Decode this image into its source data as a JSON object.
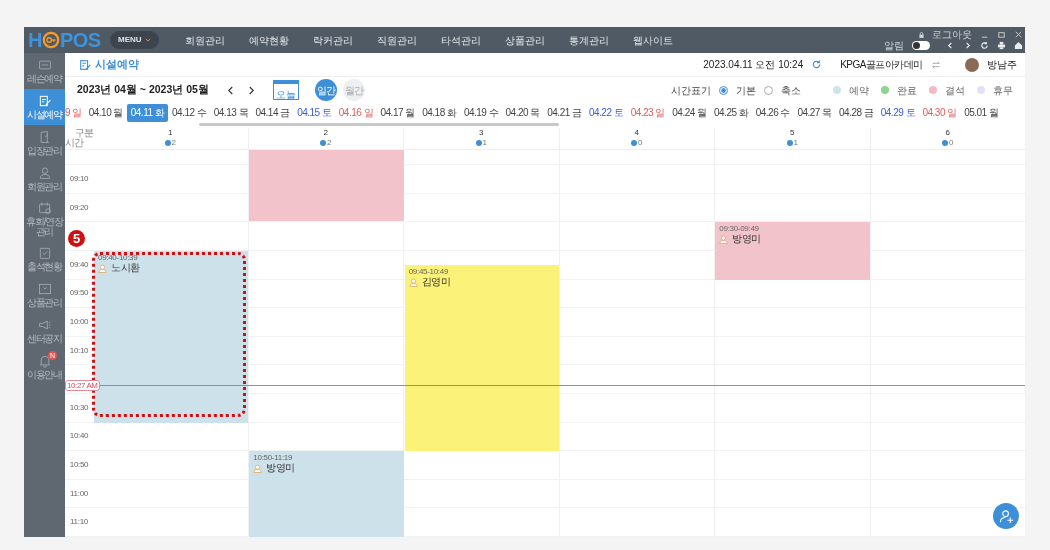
{
  "topbar": {
    "logo": [
      "H",
      "POS"
    ],
    "menu_button": "MENU",
    "nav": [
      "회원관리",
      "예약현황",
      "락커관리",
      "직원관리",
      "타석관리",
      "상품관리",
      "통계관리",
      "웹사이트"
    ],
    "logout": "로그아웃",
    "alarm": {
      "label": "알림",
      "on": false
    }
  },
  "sidebar": {
    "items": [
      {
        "label": "레슨예약",
        "kind": "ticket",
        "selected": false
      },
      {
        "label": "시설예약",
        "kind": "edit",
        "selected": true
      },
      {
        "label": "입장관리",
        "kind": "door",
        "selected": false
      },
      {
        "label": "회원관리",
        "kind": "person",
        "selected": false
      },
      {
        "label": "휴회/연장관리",
        "kind": "calendar",
        "selected": false
      },
      {
        "label": "출석현황",
        "kind": "clipboard",
        "selected": false
      },
      {
        "label": "상품관리",
        "kind": "board",
        "selected": false
      },
      {
        "label": "센터공지",
        "kind": "megaphone",
        "selected": false
      },
      {
        "label": "이용안내",
        "kind": "bell",
        "selected": false,
        "badge": "N"
      }
    ]
  },
  "header": {
    "title": "시설예약",
    "datetime": "2023.04.11 오전 10:24",
    "center": "KPGA골프아카데미",
    "user": "방남주"
  },
  "controls": {
    "range": "2023년 04월 ~ 2023년 05월",
    "today": "오늘",
    "views": [
      {
        "label": "일간",
        "selected": true
      },
      {
        "label": "월간",
        "selected": false
      }
    ],
    "time_display": {
      "label": "시간표기",
      "options": [
        {
          "label": "기본",
          "selected": true
        },
        {
          "label": "축소",
          "selected": false
        }
      ]
    },
    "legend": [
      {
        "label": "예약",
        "color": "#cfe2ee"
      },
      {
        "label": "완료",
        "color": "#8ed48a"
      },
      {
        "label": "결석",
        "color": "#f3b9c4"
      },
      {
        "label": "휴무",
        "color": "#e4e0f6"
      }
    ]
  },
  "dates": [
    {
      "label": "9 일",
      "kind": "sun",
      "selected": false
    },
    {
      "label": "04.10 월",
      "kind": "weekday",
      "selected": false
    },
    {
      "label": "04.11 화",
      "kind": "weekday",
      "selected": true
    },
    {
      "label": "04.12 수",
      "kind": "weekday",
      "selected": false
    },
    {
      "label": "04.13 목",
      "kind": "weekday",
      "selected": false
    },
    {
      "label": "04.14 금",
      "kind": "weekday",
      "selected": false
    },
    {
      "label": "04.15 토",
      "kind": "sat",
      "selected": false
    },
    {
      "label": "04.16 일",
      "kind": "sun",
      "selected": false
    },
    {
      "label": "04.17 월",
      "kind": "weekday",
      "selected": false
    },
    {
      "label": "04.18 화",
      "kind": "weekday",
      "selected": false
    },
    {
      "label": "04.19 수",
      "kind": "weekday",
      "selected": false
    },
    {
      "label": "04.20 목",
      "kind": "weekday",
      "selected": false
    },
    {
      "label": "04.21 금",
      "kind": "weekday",
      "selected": false
    },
    {
      "label": "04.22 토",
      "kind": "sat",
      "selected": false
    },
    {
      "label": "04.23 일",
      "kind": "sun",
      "selected": false
    },
    {
      "label": "04.24 월",
      "kind": "weekday",
      "selected": false
    },
    {
      "label": "04.25 화",
      "kind": "weekday",
      "selected": false
    },
    {
      "label": "04.26 수",
      "kind": "weekday",
      "selected": false
    },
    {
      "label": "04.27 목",
      "kind": "weekday",
      "selected": false
    },
    {
      "label": "04.28 금",
      "kind": "weekday",
      "selected": false
    },
    {
      "label": "04.29 토",
      "kind": "sat",
      "selected": false
    },
    {
      "label": "04.30 일",
      "kind": "sun",
      "selected": false
    },
    {
      "label": "05.01 월",
      "kind": "weekday",
      "selected": false
    }
  ],
  "grid": {
    "corner": [
      "구분",
      "시간"
    ],
    "columns": [
      {
        "label": "1",
        "count": "2",
        "events": [
          {
            "time": "09:40-10:39",
            "name": "노시환",
            "color": "#cde1eb",
            "callout": "5"
          }
        ]
      },
      {
        "label": "2",
        "count": "2",
        "events": [
          {
            "kind": "continued",
            "color": "#f3c3cb"
          },
          {
            "time": "10:50-11:19",
            "name": "방영미",
            "color": "#cde1eb"
          }
        ]
      },
      {
        "label": "3",
        "count": "1",
        "events": [
          {
            "time": "09:45-10:49",
            "name": "김영미",
            "color": "#fbf27a"
          }
        ]
      },
      {
        "label": "4",
        "count": "0"
      },
      {
        "label": "5",
        "count": "1",
        "events": [
          {
            "time": "09:30-09:49",
            "name": "방영미",
            "color": "#f3c3cb"
          }
        ]
      },
      {
        "label": "6",
        "count": "0"
      }
    ],
    "time_labels": [
      "09:10",
      "09:20",
      "09:40",
      "09:50",
      "10:00",
      "10:10",
      "10:30",
      "10:40",
      "10:50",
      "11:00",
      "11:10"
    ],
    "now": "10:27 AM"
  }
}
